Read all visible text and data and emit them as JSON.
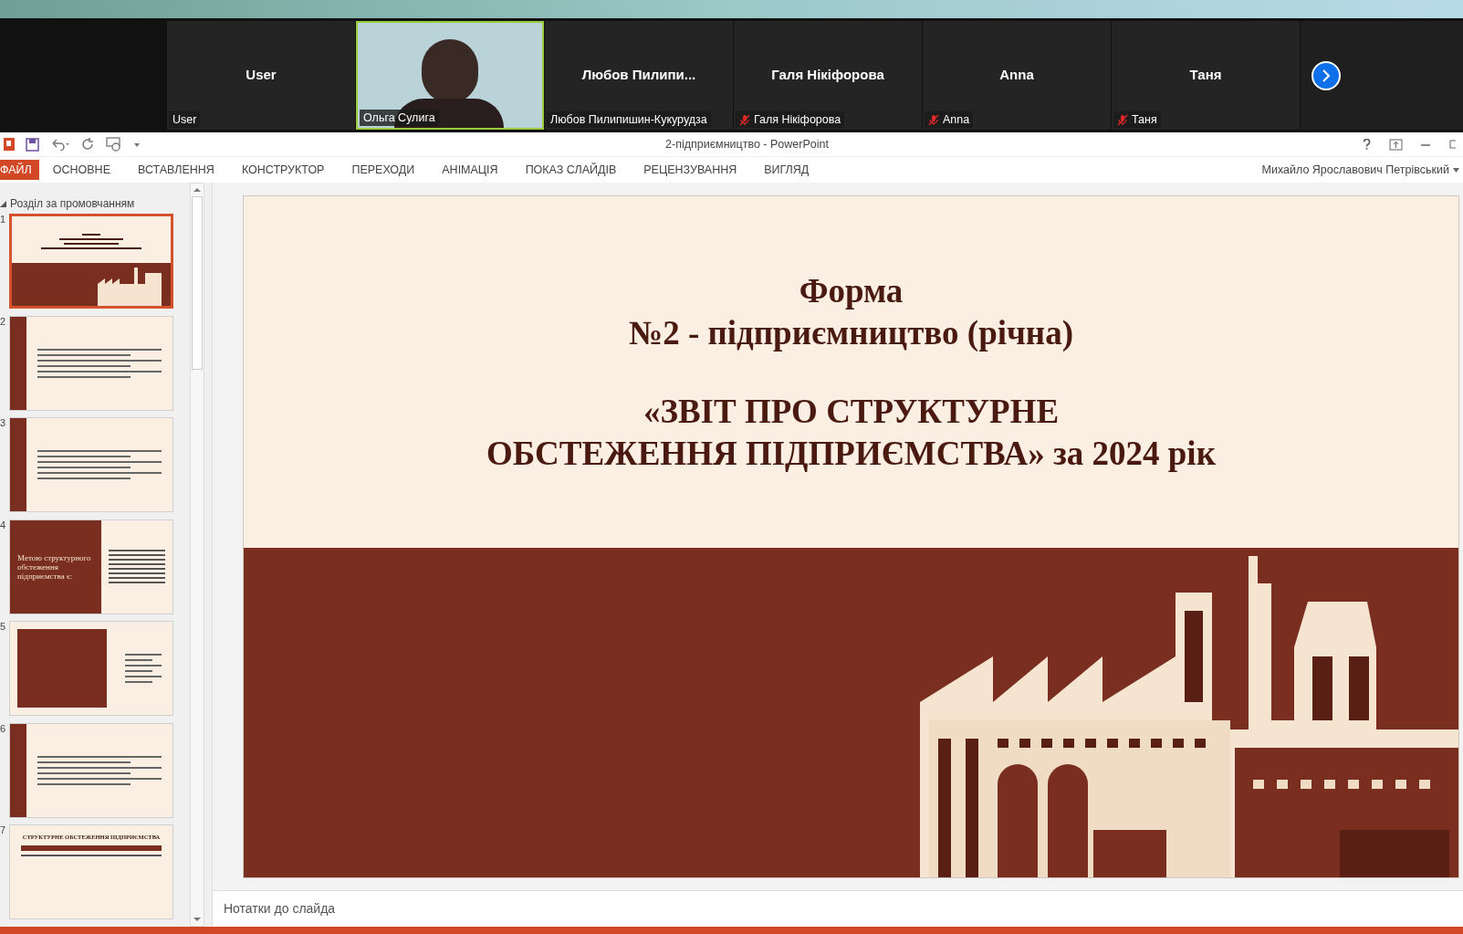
{
  "meeting": {
    "participants": [
      {
        "kind": "avatar",
        "name": "User",
        "label": "User",
        "muted": false
      },
      {
        "kind": "video",
        "label": "Ольга Сулига",
        "muted": false
      },
      {
        "kind": "avatar",
        "name": "Любов  Пилипи...",
        "label": "Любов Пилипишин-Кукурудза",
        "muted": false
      },
      {
        "kind": "avatar",
        "name": "Галя Нікіфорова",
        "label": "Галя Нікіфорова",
        "muted": true
      },
      {
        "kind": "avatar",
        "name": "Anna",
        "label": "Anna",
        "muted": true
      },
      {
        "kind": "avatar",
        "name": "Таня",
        "label": "Таня",
        "muted": true
      }
    ]
  },
  "window": {
    "title": "2-підприємництво - PowerPoint",
    "user": "Михайло Ярославович Петрівський"
  },
  "ribbon_tabs": [
    {
      "label": "ФАЙЛ",
      "kind": "file"
    },
    {
      "label": "ОСНОВНЕ",
      "kind": "tab"
    },
    {
      "label": "ВСТАВЛЕННЯ",
      "kind": "tab"
    },
    {
      "label": "КОНСТРУКТОР",
      "kind": "tab"
    },
    {
      "label": "ПЕРЕХОДИ",
      "kind": "tab"
    },
    {
      "label": "АНІМАЦІЯ",
      "kind": "tab"
    },
    {
      "label": "ПОКАЗ СЛАЙДІВ",
      "kind": "tab"
    },
    {
      "label": "РЕЦЕНЗУВАННЯ",
      "kind": "tab"
    },
    {
      "label": "ВИГЛЯД",
      "kind": "tab"
    }
  ],
  "sidebar": {
    "section": "Розділ за промовчанням",
    "expanded": true,
    "slides": [
      {
        "number": "1",
        "kind": "title",
        "selected": true
      },
      {
        "number": "2",
        "kind": "columns",
        "selected": false
      },
      {
        "number": "3",
        "kind": "boxes",
        "selected": false
      },
      {
        "number": "4",
        "kind": "split",
        "selected": false,
        "lines": [
          "Метою структурного обстеження підприємства є:"
        ]
      },
      {
        "number": "5",
        "kind": "split2",
        "selected": false
      },
      {
        "number": "6",
        "kind": "form",
        "selected": false
      },
      {
        "number": "7",
        "kind": "table",
        "selected": false,
        "lines": [
          "СТРУКТУРНЕ ОБСТЕЖЕННЯ ПІДПРИЄМСТВА"
        ]
      }
    ]
  },
  "slide": {
    "title_lines": [
      "Форма",
      "№2 - підприємництво (річна)"
    ],
    "subtitle_lines": [
      "«ЗВІТ ПРО СТРУКТУРНЕ",
      "ОБСТЕЖЕННЯ ПІДПРИЄМСТВА» за 2024 рік"
    ]
  },
  "notes": {
    "placeholder": "Нотатки до слайда"
  }
}
